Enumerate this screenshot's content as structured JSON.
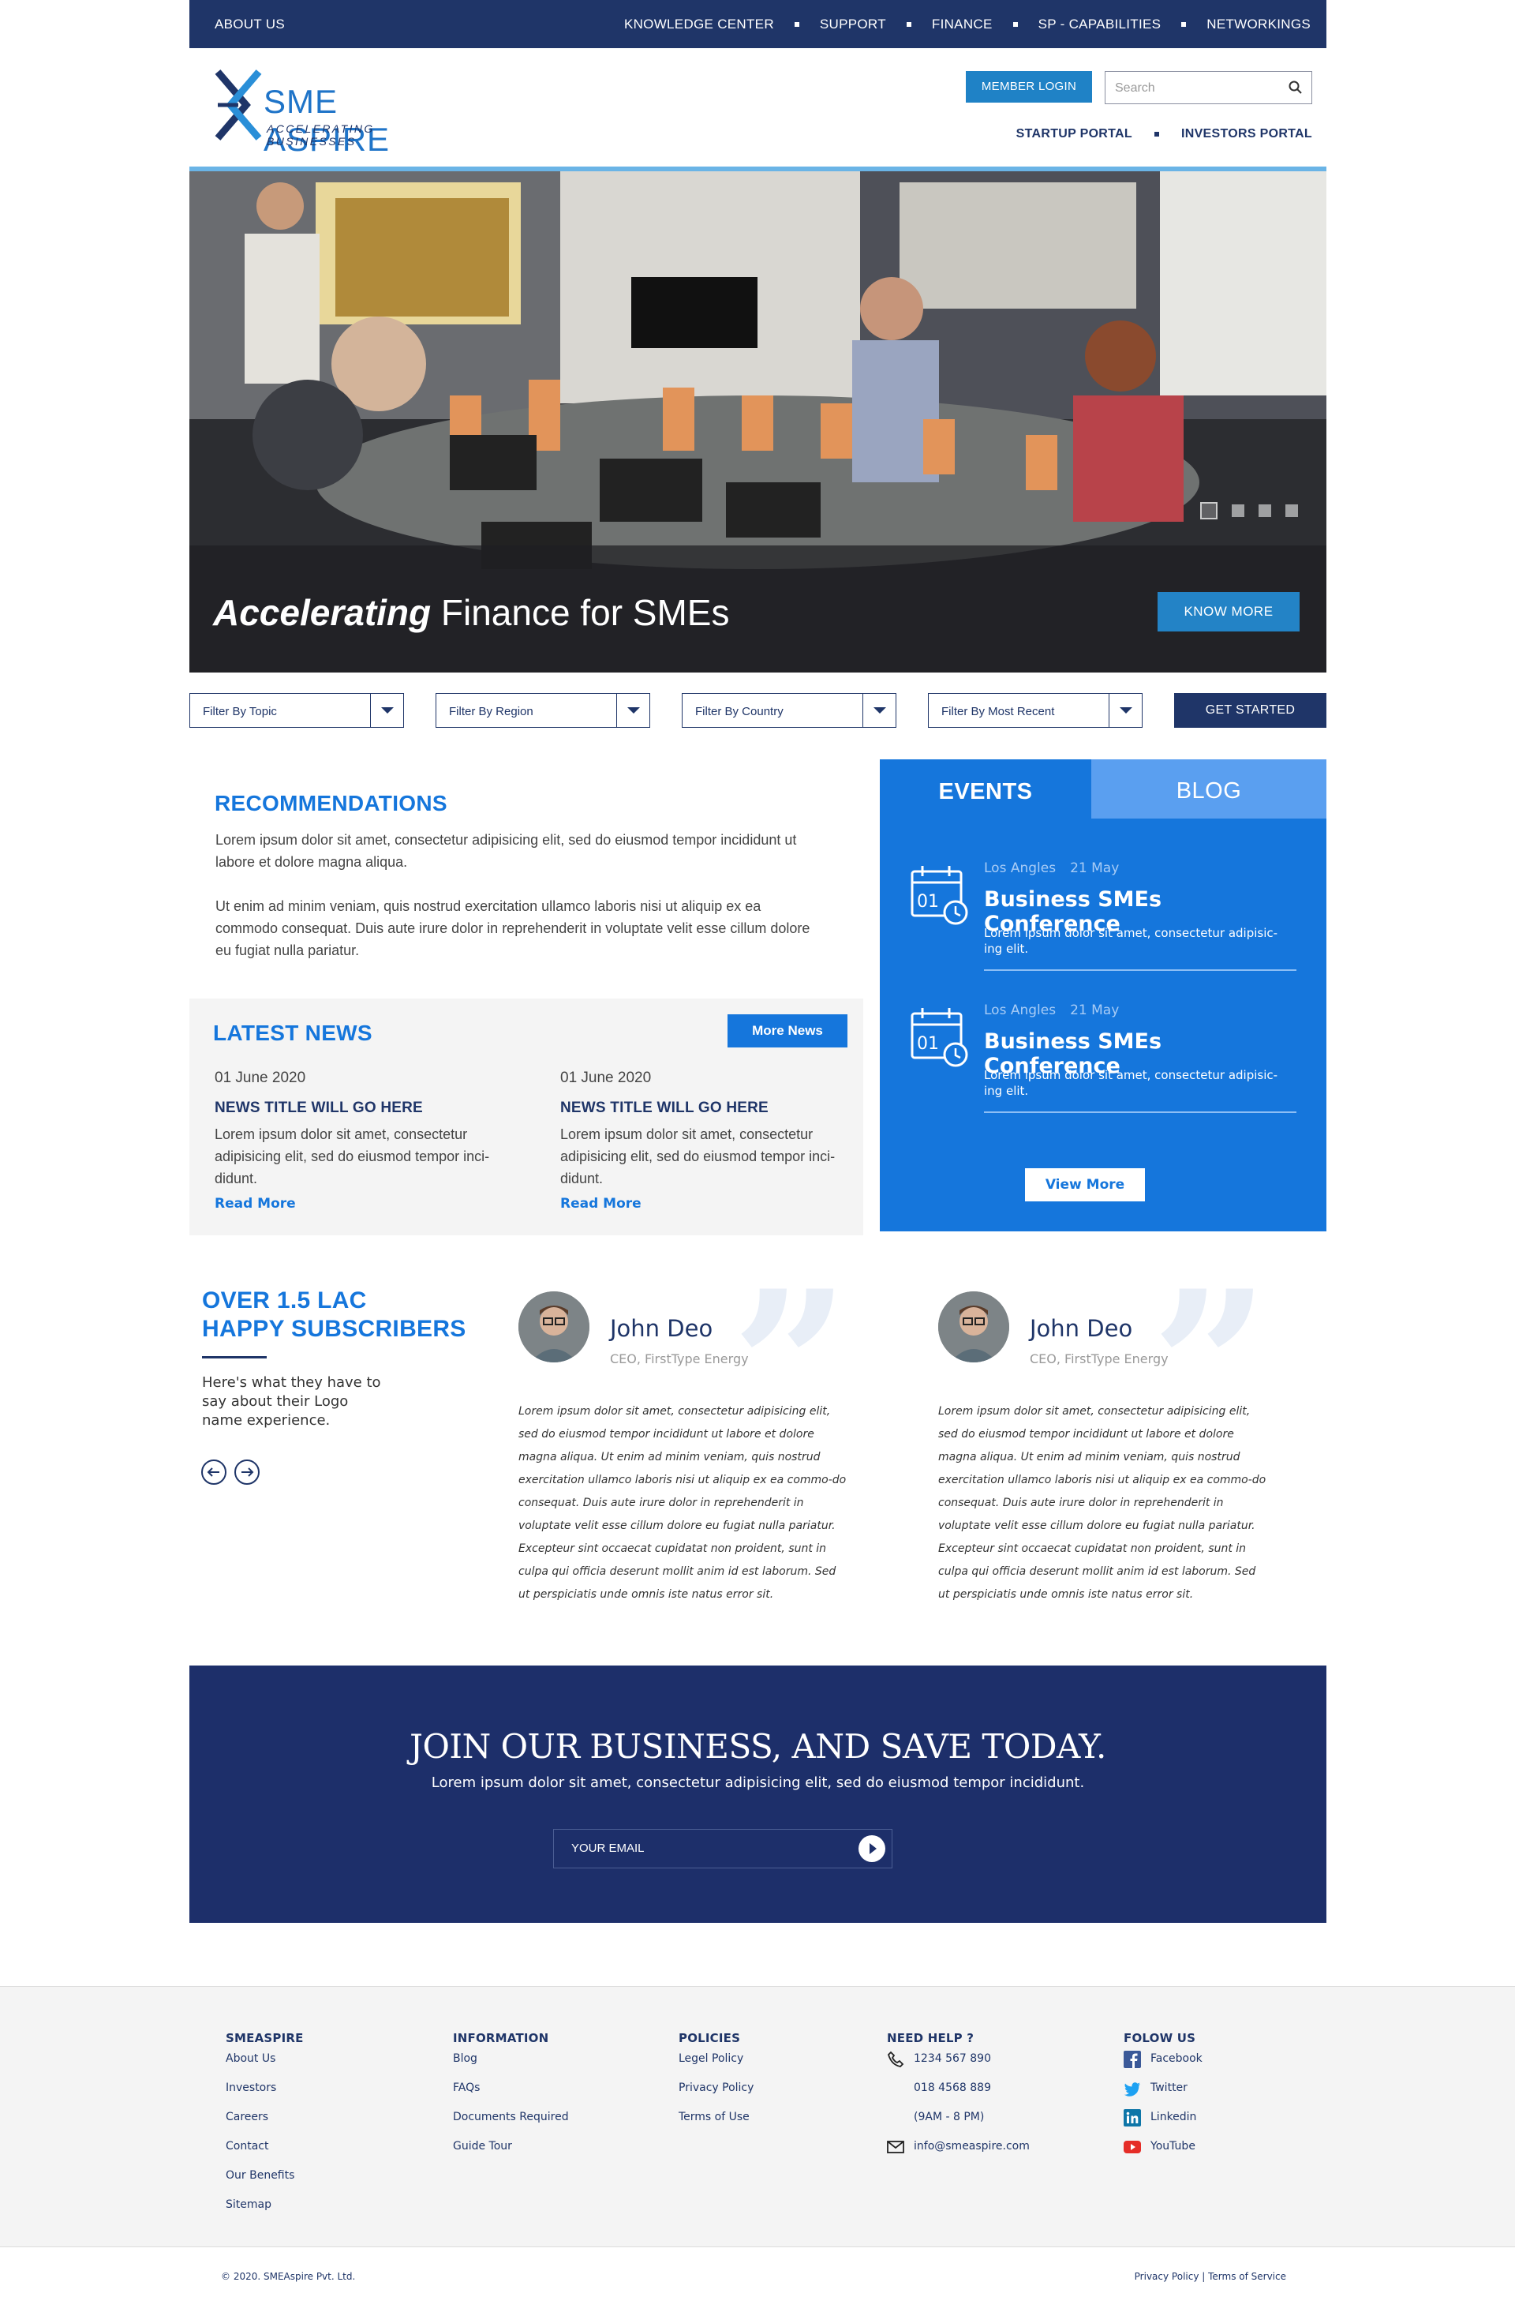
{
  "topbar": {
    "about": "ABOUT US",
    "links": [
      "KNOWLEDGE CENTER",
      "SUPPORT",
      "FINANCE",
      "SP - CAPABILITIES",
      "NETWORKINGS"
    ]
  },
  "header": {
    "logo_name": "SME ASPIRE",
    "logo_tagline": "ACCELERATING BUSINESSES",
    "member_login": "MEMBER LOGIN",
    "search_placeholder": "Search",
    "portals": [
      "STARTUP PORTAL",
      "INVESTORS PORTAL"
    ]
  },
  "hero": {
    "title_bold": "Accelerating",
    "title_rest": " Finance for SMEs",
    "button": "KNOW MORE",
    "slides": 4,
    "active_slide": 1
  },
  "filters": {
    "items": [
      "Filter By Topic",
      "Filter By Region",
      "Filter By Country",
      "Filter By Most Recent"
    ],
    "cta": "GET STARTED"
  },
  "recommendations": {
    "title": "RECOMMENDATIONS",
    "p1": "Lorem ipsum dolor sit amet, consectetur adipisicing elit, sed do eiusmod tempor incididunt ut labore et dolore magna aliqua.",
    "p2": "Ut enim ad minim veniam, quis nostrud exercitation ullamco laboris nisi ut aliquip ex ea commodo consequat. Duis aute irure dolor in reprehenderit in voluptate velit esse cillum dolore eu fugiat nulla pariatur."
  },
  "news": {
    "title": "LATEST NEWS",
    "more": "More News",
    "items": [
      {
        "date": "01 June 2020",
        "title": "NEWS TITLE WILL GO HERE",
        "text": "Lorem ipsum dolor sit amet, consectetur adipisicing elit, sed do eiusmod tempor inci-didunt.",
        "read": "Read More"
      },
      {
        "date": "01 June 2020",
        "title": "NEWS TITLE WILL GO HERE",
        "text": "Lorem ipsum dolor sit amet, consectetur adipisicing elit, sed do eiusmod tempor inci-didunt.",
        "read": "Read More"
      }
    ]
  },
  "events": {
    "tab_events": "EVENTS",
    "tab_blog": "BLOG",
    "items": [
      {
        "city": "Los Angles",
        "date": "21 May",
        "title": "Business SMEs Conference",
        "text": "Lorem ipsum dolor sit amet, consectetur adipisic-ing elit.",
        "day": "01"
      },
      {
        "city": "Los Angles",
        "date": "21 May",
        "title": "Business SMEs Conference",
        "text": "Lorem ipsum dolor sit amet, consectetur adipisic-ing elit.",
        "day": "01"
      }
    ],
    "view_more": "View More"
  },
  "subscribers": {
    "line1": "OVER 1.5 LAC",
    "line2": "HAPPY SUBSCRIBERS",
    "desc": "Here's what they have to say about their Logo name experience.",
    "testimonials": [
      {
        "name": "John Deo",
        "role": "CEO, FirstType Energy",
        "body": "Lorem ipsum dolor sit amet, consectetur adipisicing elit, sed do eiusmod tempor incididunt ut labore et dolore magna aliqua. Ut enim ad minim veniam, quis nostrud exercitation ullamco laboris nisi ut aliquip ex ea commo-do consequat. Duis aute irure dolor in reprehenderit in voluptate velit esse cillum dolore eu fugiat nulla pariatur. Excepteur sint occaecat cupidatat non proident, sunt in culpa qui officia deserunt mollit anim id est laborum. Sed ut perspiciatis unde omnis iste natus error sit."
      },
      {
        "name": "John Deo",
        "role": "CEO, FirstType Energy",
        "body": "Lorem ipsum dolor sit amet, consectetur adipisicing elit, sed do eiusmod tempor incididunt ut labore et dolore magna aliqua. Ut enim ad minim veniam, quis nostrud exercitation ullamco laboris nisi ut aliquip ex ea commo-do consequat. Duis aute irure dolor in reprehenderit in voluptate velit esse cillum dolore eu fugiat nulla pariatur. Excepteur sint occaecat cupidatat non proident, sunt in culpa qui officia deserunt mollit anim id est laborum. Sed ut perspiciatis unde omnis iste natus error sit."
      }
    ]
  },
  "join": {
    "heading": "JOIN OUR BUSINESS, AND SAVE TODAY.",
    "sub": "Lorem ipsum dolor sit amet, consectetur adipisicing elit, sed do eiusmod tempor incididunt.",
    "email_placeholder": "YOUR EMAIL"
  },
  "footer": {
    "col1": {
      "title": "SMEASPIRE",
      "links": [
        "About Us",
        "Investors",
        "Careers",
        "Contact",
        "Our Benefits",
        "Sitemap"
      ]
    },
    "col2": {
      "title": "INFORMATION",
      "links": [
        "Blog",
        "FAQs",
        "Documents Required",
        "Guide Tour"
      ]
    },
    "col3": {
      "title": "POLICIES",
      "links": [
        "Legel Policy",
        "Privacy Policy",
        "Terms of Use"
      ]
    },
    "col4": {
      "title": "NEED HELP ?",
      "phone1": "1234 567 890",
      "phone2": "018 4568 889",
      "hours": "(9AM - 8 PM)",
      "email": "info@smeaspire.com"
    },
    "col5": {
      "title": "FOLOW US",
      "links": [
        "Facebook",
        "Twitter",
        "Linkedin",
        "YouTube"
      ]
    },
    "copyright": "© 2020. SMEAspire Pvt. Ltd.",
    "bottom_links": "Privacy Policy | Terms of Service"
  },
  "colors": {
    "navy": "#1f3568",
    "blue": "#1576dc",
    "light_blue": "#5a9ff0",
    "button_blue": "#2383c6"
  }
}
